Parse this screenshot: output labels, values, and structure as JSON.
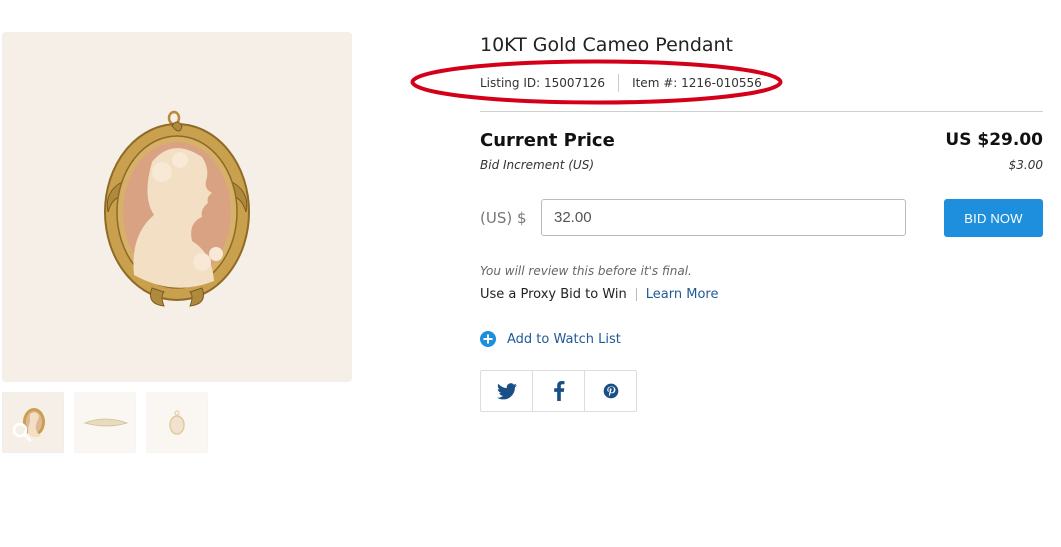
{
  "product": {
    "title": "10KT Gold Cameo Pendant",
    "listing_id": "Listing ID: 15007126",
    "item_number": "Item #: 1216-010556"
  },
  "pricing": {
    "current_price_label": "Current Price",
    "current_price_value": "US $29.00",
    "bid_increment_label": "Bid Increment (US)",
    "bid_increment_value": "$3.00"
  },
  "bid_form": {
    "currency_label": "(US) $",
    "bid_value": "32.00",
    "bid_button_label": "BID NOW",
    "review_note": "You will review this before it's final.",
    "proxy_text": "Use a Proxy Bid to Win",
    "learn_more": "Learn More"
  },
  "watch": {
    "label": "Add to Watch List",
    "icon": "plus-circle-icon"
  },
  "social": {
    "icons": [
      "twitter-icon",
      "facebook-icon",
      "pinterest-icon"
    ]
  },
  "colors": {
    "accent_blue": "#1e8fdc",
    "link_blue": "#1f5a96",
    "highlight_red": "#d4001a"
  }
}
